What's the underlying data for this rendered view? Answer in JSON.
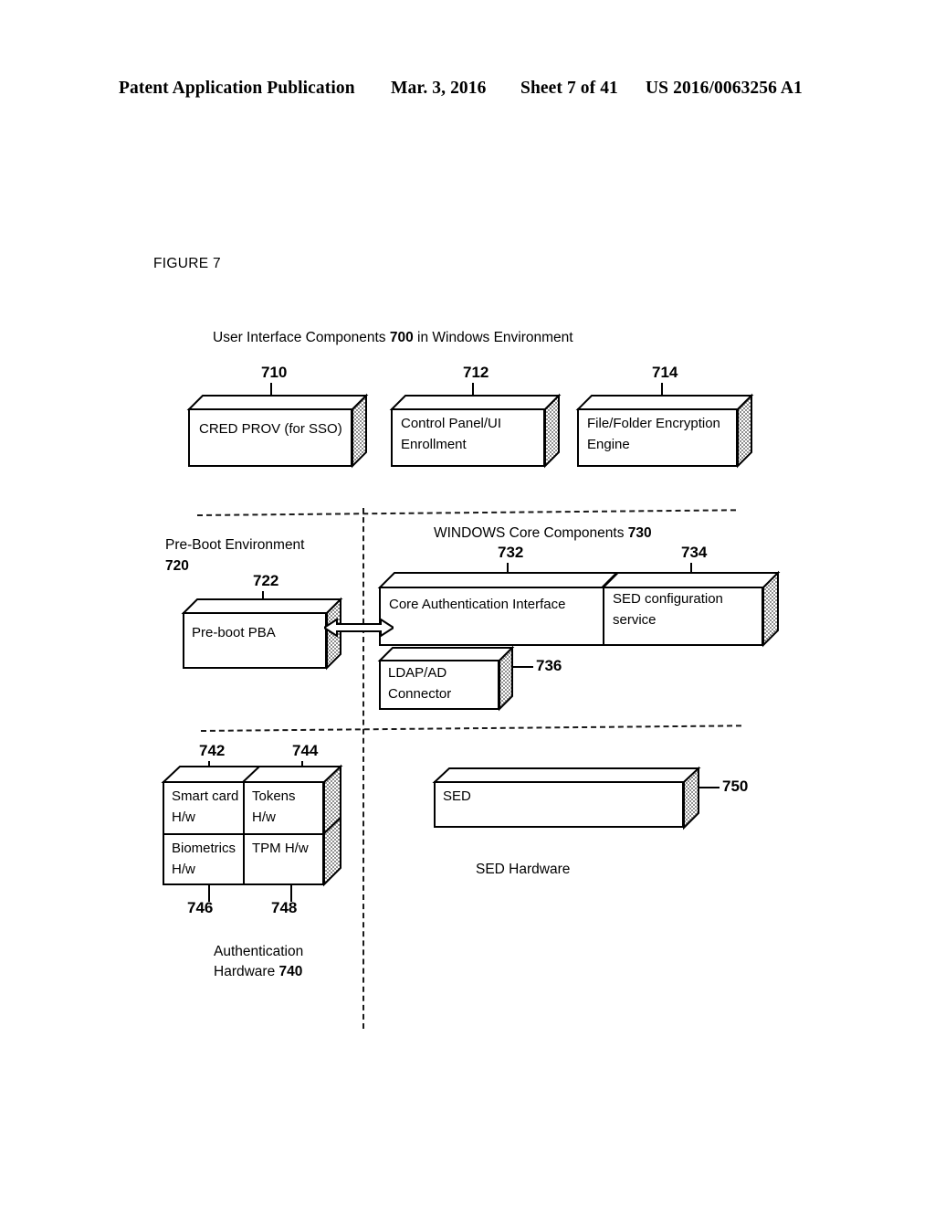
{
  "header": {
    "publication": "Patent Application Publication",
    "date": "Mar. 3, 2016",
    "sheet": "Sheet 7 of 41",
    "number": "US 2016/0063256 A1"
  },
  "figure": {
    "label": "FIGURE 7",
    "title_prefix": "User Interface Components ",
    "title_ref": "700",
    "title_suffix": " in Windows Environment"
  },
  "ui_components": {
    "boxes": [
      {
        "ref": "710",
        "text": "CRED PROV (for SSO)"
      },
      {
        "ref": "712",
        "text": "Control Panel/UI\nEnrollment"
      },
      {
        "ref": "714",
        "text": "File/Folder Encryption\nEngine"
      }
    ]
  },
  "preboot": {
    "env_label": "Pre-Boot Environment",
    "env_ref": "720",
    "box_ref": "722",
    "box_text": "Pre-boot  PBA"
  },
  "windows_core": {
    "group_label_prefix": "WINDOWS Core Components ",
    "group_ref": "730",
    "cells": [
      {
        "ref": "732",
        "text": "Core Authentication Interface"
      },
      {
        "ref": "734",
        "text": "SED configuration\nservice"
      }
    ],
    "connector": {
      "ref": "736",
      "text": "LDAP/AD\nConnector"
    }
  },
  "auth_hardware": {
    "caption_line1": "Authentication",
    "caption_line2_prefix": "Hardware ",
    "caption_ref": "740",
    "cells": [
      {
        "ref": "742",
        "text": "Smart card\nH/w"
      },
      {
        "ref": "744",
        "text": "Tokens\nH/w"
      },
      {
        "ref": "746",
        "text": "Biometrics\nH/w"
      },
      {
        "ref": "748",
        "text": "TPM H/w"
      }
    ]
  },
  "sed_hardware": {
    "box_ref": "750",
    "box_text": "SED",
    "caption": "SED Hardware"
  }
}
